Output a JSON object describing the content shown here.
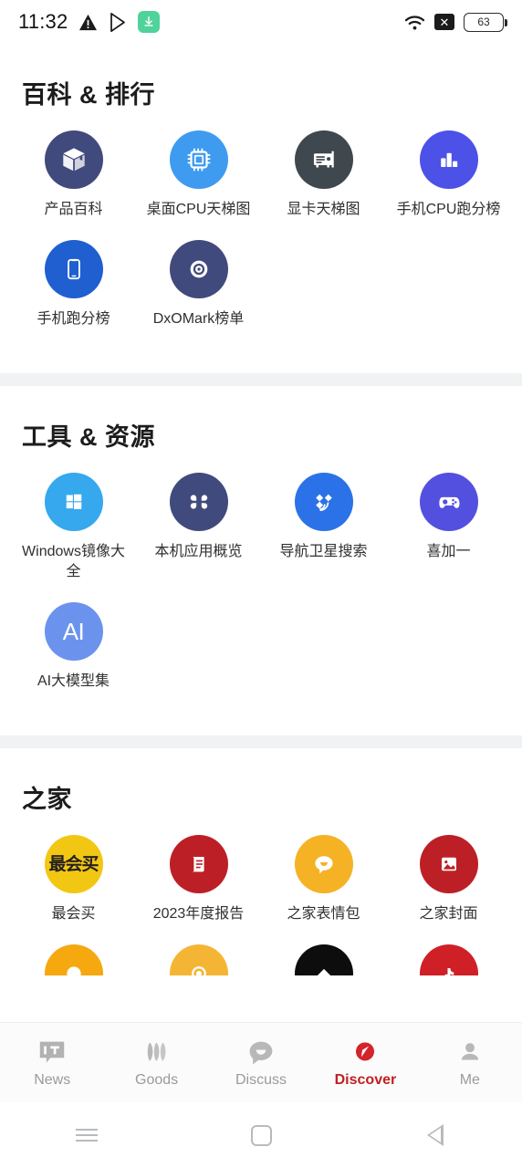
{
  "statusbar": {
    "time": "11:32",
    "battery_level": "63",
    "icons": [
      "warning-triangle-icon",
      "play-store-icon",
      "download-icon",
      "wifi-icon",
      "no-signal-icon",
      "battery-icon"
    ]
  },
  "sections": [
    {
      "title": "百科 & 排行",
      "items": [
        {
          "label": "产品百科",
          "icon": "box-icon",
          "bg": "#414a7c",
          "fg": "#ffffff"
        },
        {
          "label": "桌面CPU天梯图",
          "icon": "cpu-chip-icon",
          "bg": "#3f9bf0",
          "fg": "#ffffff"
        },
        {
          "label": "显卡天梯图",
          "icon": "graphics-card-icon",
          "bg": "#3f474f",
          "fg": "#ffffff"
        },
        {
          "label": "手机CPU跑分榜",
          "icon": "bar-chart-icon",
          "bg": "#4c51e8",
          "fg": "#ffffff"
        },
        {
          "label": "手机跑分榜",
          "icon": "smartphone-icon",
          "bg": "#1f5fd0",
          "fg": "#ffffff"
        },
        {
          "label": "DxOMark榜单",
          "icon": "camera-lens-icon",
          "bg": "#414a7c",
          "fg": "#ffffff"
        }
      ]
    },
    {
      "title": "工具 & 资源",
      "items": [
        {
          "label": "Windows镜像大全",
          "icon": "windows-logo-icon",
          "bg": "#35a8ee",
          "fg": "#ffffff"
        },
        {
          "label": "本机应用概览",
          "icon": "apps-grid-icon",
          "bg": "#414a7c",
          "fg": "#ffffff"
        },
        {
          "label": "导航卫星搜索",
          "icon": "satellite-icon",
          "bg": "#2b72e8",
          "fg": "#ffffff"
        },
        {
          "label": "喜加一",
          "icon": "game-controller-icon",
          "bg": "#5350e0",
          "fg": "#ffffff"
        },
        {
          "label": "AI大模型集",
          "icon": "ai-text-icon",
          "bg": "#6b93ed",
          "fg": "#ffffff",
          "text": "AI"
        }
      ]
    },
    {
      "title": "之家",
      "items": [
        {
          "label": "最会买",
          "icon": "zuihuimai-text-icon",
          "bg": "#f2c713",
          "fg": "#231f20",
          "text": "最会买"
        },
        {
          "label": "2023年度报告",
          "icon": "report-book-icon",
          "bg": "#bc2026",
          "fg": "#ffffff"
        },
        {
          "label": "之家表情包",
          "icon": "chat-smile-icon",
          "bg": "#f5b225",
          "fg": "#ffffff"
        },
        {
          "label": "之家封面",
          "icon": "image-picture-icon",
          "bg": "#bc2026",
          "fg": "#ffffff"
        }
      ],
      "partial_items": [
        {
          "label": "",
          "icon": "ring-icon",
          "bg": "#f6a80f",
          "fg": "#ffffff"
        },
        {
          "label": "",
          "icon": "target-ring-icon",
          "bg": "#f5b534",
          "fg": "#ffffff"
        },
        {
          "label": "",
          "icon": "mascot-icon",
          "bg": "#0d0d0d",
          "fg": "#ffffff"
        },
        {
          "label": "",
          "icon": "music-note-icon",
          "bg": "#cf2027",
          "fg": "#ffffff"
        }
      ]
    }
  ],
  "tabbar": {
    "active_color": "#c01f21",
    "inactive_color": "#9a9a9a",
    "tabs": [
      {
        "label": "News",
        "icon": "it-news-icon",
        "active": false
      },
      {
        "label": "Goods",
        "icon": "goods-icon",
        "active": false
      },
      {
        "label": "Discuss",
        "icon": "chat-bubble-icon",
        "active": false
      },
      {
        "label": "Discover",
        "icon": "compass-icon",
        "active": true
      },
      {
        "label": "Me",
        "icon": "person-icon",
        "active": false
      }
    ]
  },
  "navbar": {
    "buttons": [
      {
        "name": "recents-button"
      },
      {
        "name": "home-button"
      },
      {
        "name": "back-button"
      }
    ]
  }
}
